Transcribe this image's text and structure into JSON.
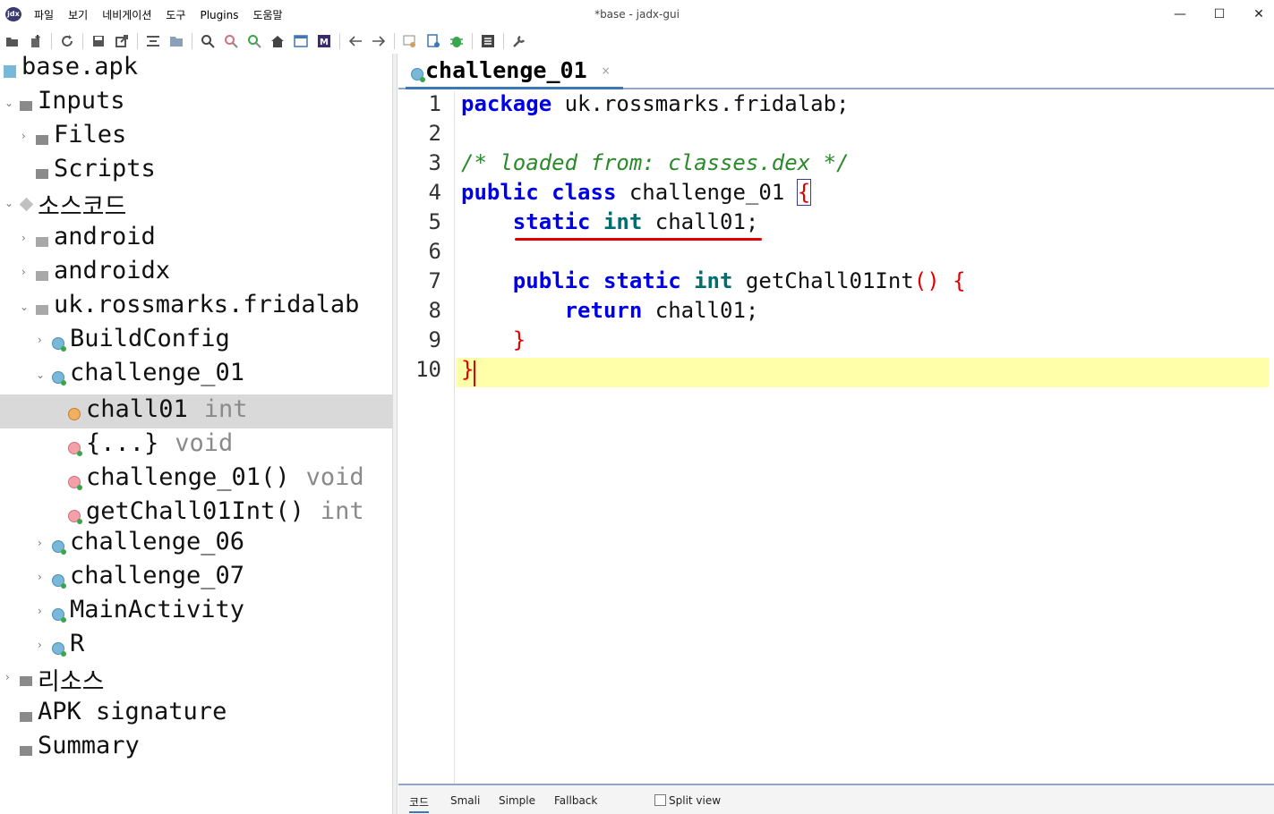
{
  "window": {
    "title": "*base - jadx-gui",
    "app_icon_label": "jdx",
    "controls": {
      "minimize": "—",
      "maximize": "☐",
      "close": "✕"
    }
  },
  "menu": [
    "파일",
    "보기",
    "네비게이션",
    "도구",
    "Plugins",
    "도움말"
  ],
  "toolbar_icons": [
    "open-icon",
    "add-files-icon",
    "reload-icon",
    "save-icon",
    "export-icon",
    "sync-icon",
    "flatten-icon",
    "search-icon",
    "find-usage-icon",
    "search-class-icon",
    "home-icon",
    "window-icon",
    "smali-icon",
    "back-icon",
    "forward-icon",
    "deobf-icon",
    "quark-icon",
    "debug-icon",
    "log-icon",
    "prefs-icon"
  ],
  "tree": {
    "root": "base.apk",
    "inputs": "Inputs",
    "files": "Files",
    "scripts": "Scripts",
    "source_code": "소스코드",
    "pkg_android": "android",
    "pkg_androidx": "androidx",
    "pkg_fridalab": "uk.rossmarks.fridalab",
    "build_config": "BuildConfig",
    "challenge_01": "challenge_01",
    "field_chall01": {
      "name": "chall01",
      "type": "int"
    },
    "static_init": {
      "name": "{...}",
      "type": "void"
    },
    "ctor": {
      "name": "challenge_01()",
      "type": "void"
    },
    "getter": {
      "name": "getChall01Int()",
      "type": "int"
    },
    "challenge_06": "challenge_06",
    "challenge_07": "challenge_07",
    "main_activity": "MainActivity",
    "r_class": "R",
    "resources": "리소스",
    "apk_signature": "APK signature",
    "summary": "Summary"
  },
  "editor": {
    "tab_title": "challenge_01",
    "tab_close": "×",
    "line_numbers": [
      "1",
      "2",
      "3",
      "4",
      "5",
      "6",
      "7",
      "8",
      "9",
      "10"
    ],
    "code": {
      "l1_kw": "package",
      "l1_rest": " uk.rossmarks.fridalab;",
      "l3_comment": "/* loaded from: classes.dex */",
      "l4_kw1": "public",
      "l4_kw2": "class",
      "l4_name": " challenge_01 ",
      "l4_brace": "{",
      "l5_kw1": "static",
      "l5_kw2": "int",
      "l5_rest": " chall01;",
      "l7_kw1": "public",
      "l7_kw2": "static",
      "l7_kw3": "int",
      "l7_name": " getChall01Int",
      "l7_parens": "()",
      "l7_brace": "{",
      "l8_kw": "return",
      "l8_rest": " chall01;",
      "l9_brace": "}",
      "l10_brace": "}"
    },
    "current_line": 10
  },
  "bottom_tabs": {
    "code": "코드",
    "smali": "Smali",
    "simple": "Simple",
    "fallback": "Fallback",
    "split_view": "Split view",
    "split_view_checked": false
  },
  "colors": {
    "keyword": "#0000e6",
    "type_keyword": "#006e6e",
    "comment": "#2a8a2a",
    "brace": "#e00000",
    "current_line_bg": "#ffffaa",
    "selection_bg": "#d9d9d9",
    "annotation": "#e00000"
  }
}
